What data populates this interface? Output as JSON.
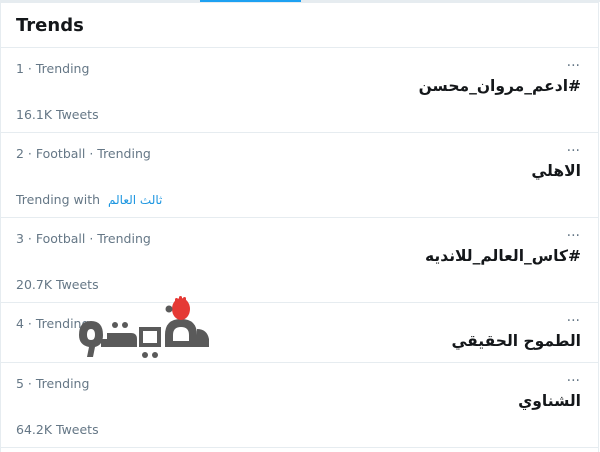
{
  "header": {
    "title": "Trends"
  },
  "more_label": "···",
  "trends": [
    {
      "meta": "1 · Trending",
      "title": "#ادعم_مروان_محسن",
      "count": "16.1K Tweets"
    },
    {
      "meta": "2 · Football · Trending",
      "title": "الاهلي",
      "count_prefix": "Trending with",
      "count_link": "ثالث العالم"
    },
    {
      "meta": "3 · Football · Trending",
      "title": "#كاس_العالم_للانديه",
      "count": "20.7K Tweets"
    },
    {
      "meta": "4 · Trending",
      "title": "الطموح الحقيقي"
    },
    {
      "meta": "5 · Trending",
      "title": "الشناوي",
      "count": "64.2K Tweets"
    }
  ],
  "watermark": {
    "text": "فيتو"
  }
}
